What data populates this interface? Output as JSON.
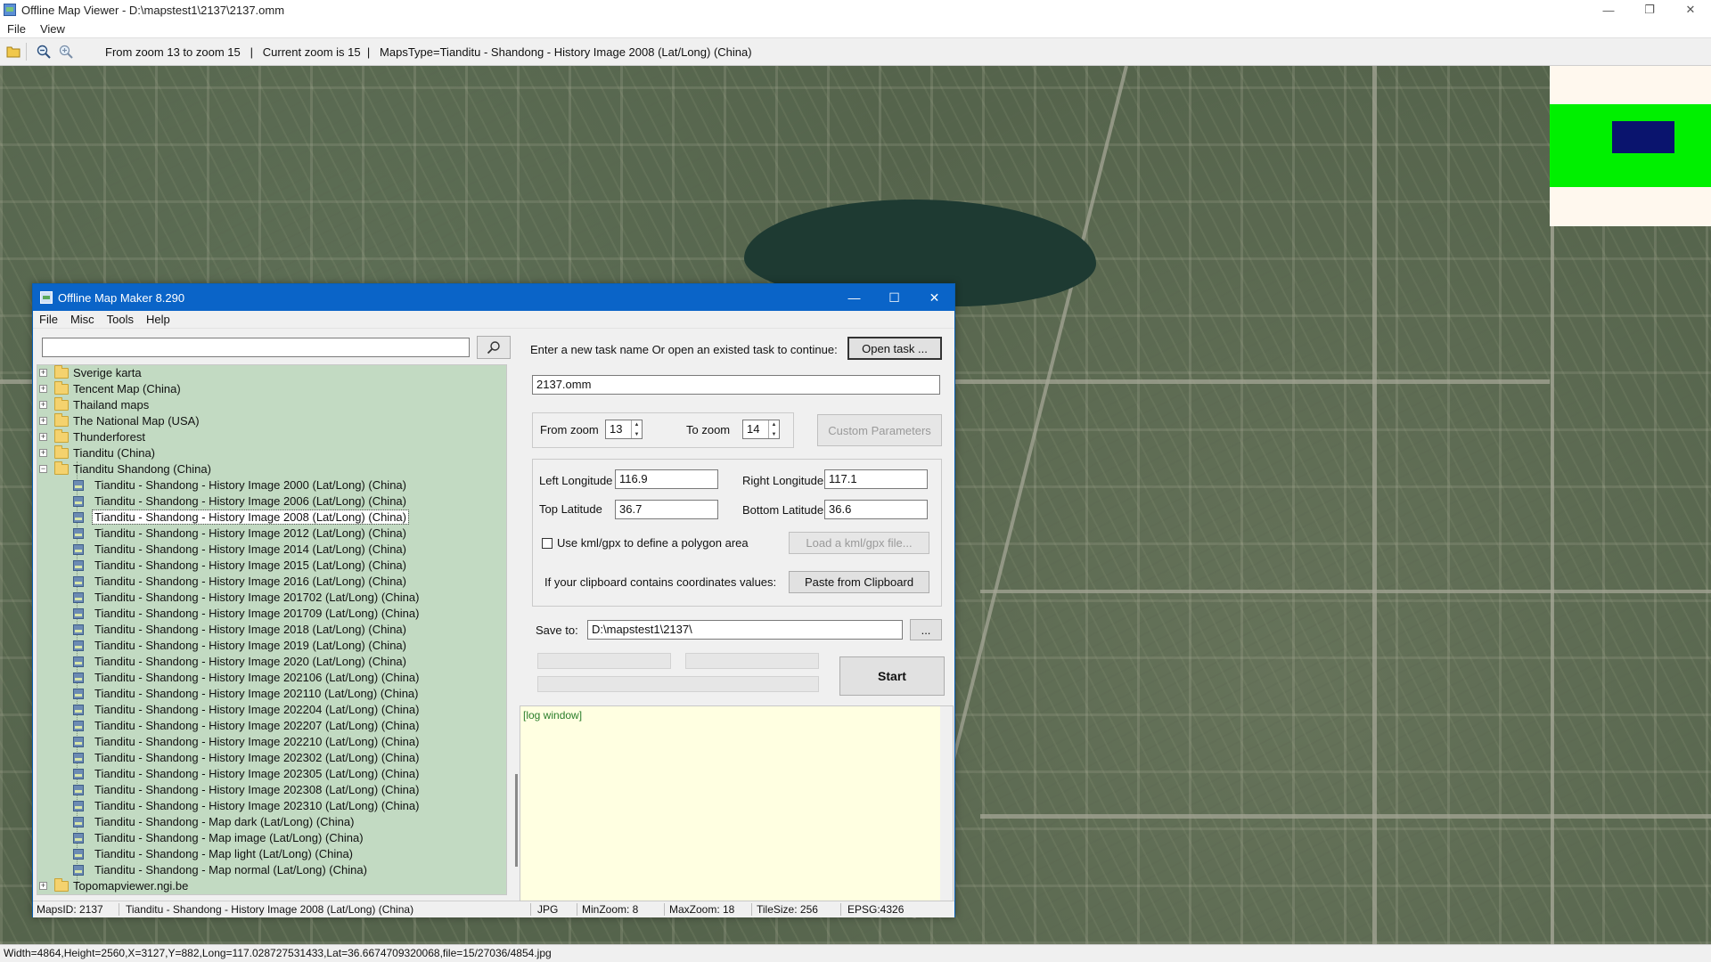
{
  "window": {
    "title": "Offline Map Viewer - D:\\mapstest1\\2137\\2137.omm",
    "controls": {
      "minimize": "—",
      "restore": "❐",
      "close": "✕"
    }
  },
  "menu": {
    "file": "File",
    "view": "View"
  },
  "toolbar": {
    "icons": [
      "open-folder-icon",
      "zoom-out-icon",
      "zoom-in-icon"
    ],
    "info": "From zoom 13 to zoom 15   |   Current zoom is 15  |   MapsType=Tianditu - Shandong - History Image 2008 (Lat/Long) (China)"
  },
  "status_main": "Width=4864,Height=2560,X=3127,Y=882,Long=117.028727531433,Lat=36.6674709320068,file=15/27036/4854.jpg",
  "colors": {
    "overview_land": "#00f000",
    "overview_view": "#0a146e",
    "dialog_title_bg": "#0a64c8",
    "tree_bg": "#c2dac2",
    "log_bg": "#ffffe1"
  },
  "dialog": {
    "title": "Offline Map Maker 8.290",
    "menu": [
      "File",
      "Misc",
      "Tools",
      "Help"
    ],
    "search": {
      "value": "",
      "icon": "search-icon"
    },
    "tree": {
      "folders_before": [
        "Sverige karta",
        "Tencent Map (China)",
        "Thailand maps",
        "The National Map (USA)",
        "Thunderforest",
        "Tianditu (China)"
      ],
      "expanded_folder": "Tianditu Shandong (China)",
      "children": [
        "Tianditu - Shandong - History Image 2000 (Lat/Long) (China)",
        "Tianditu - Shandong - History Image 2006 (Lat/Long) (China)",
        "Tianditu - Shandong - History Image 2008 (Lat/Long) (China)",
        "Tianditu - Shandong - History Image 2012 (Lat/Long) (China)",
        "Tianditu - Shandong - History Image 2014 (Lat/Long) (China)",
        "Tianditu - Shandong - History Image 2015 (Lat/Long) (China)",
        "Tianditu - Shandong - History Image 2016 (Lat/Long) (China)",
        "Tianditu - Shandong - History Image 201702 (Lat/Long) (China)",
        "Tianditu - Shandong - History Image 201709 (Lat/Long) (China)",
        "Tianditu - Shandong - History Image 2018 (Lat/Long) (China)",
        "Tianditu - Shandong - History Image 2019 (Lat/Long) (China)",
        "Tianditu - Shandong - History Image 2020 (Lat/Long) (China)",
        "Tianditu - Shandong - History Image 202106 (Lat/Long) (China)",
        "Tianditu - Shandong - History Image 202110 (Lat/Long) (China)",
        "Tianditu - Shandong - History Image 202204 (Lat/Long) (China)",
        "Tianditu - Shandong - History Image 202207 (Lat/Long) (China)",
        "Tianditu - Shandong - History Image 202210 (Lat/Long) (China)",
        "Tianditu - Shandong - History Image 202302 (Lat/Long) (China)",
        "Tianditu - Shandong - History Image 202305 (Lat/Long) (China)",
        "Tianditu - Shandong - History Image 202308 (Lat/Long) (China)",
        "Tianditu - Shandong - History Image 202310 (Lat/Long) (China)",
        "Tianditu - Shandong - Map dark (Lat/Long) (China)",
        "Tianditu - Shandong - Map image (Lat/Long) (China)",
        "Tianditu - Shandong - Map light (Lat/Long) (China)",
        "Tianditu - Shandong - Map normal (Lat/Long) (China)"
      ],
      "selected_index": 2,
      "folders_after": [
        "Topomapviewer.ngi.be"
      ]
    },
    "task": {
      "prompt": "Enter a new task name Or open an existed task to continue:",
      "open_button": "Open task ...",
      "name_value": "2137.omm"
    },
    "zoom": {
      "from_label": "From zoom",
      "from_value": "13",
      "to_label": "To zoom",
      "to_value": "14",
      "custom_button": "Custom Parameters"
    },
    "coords": {
      "left_lon_label": "Left Longitude",
      "left_lon": "116.9",
      "right_lon_label": "Right Longitude",
      "right_lon": "117.1",
      "top_lat_label": "Top Latitude",
      "top_lat": "36.7",
      "bottom_lat_label": "Bottom Latitude",
      "bottom_lat": "36.6",
      "kml_label": "Use kml/gpx to define a polygon area",
      "kml_checked": false,
      "kml_button": "Load a kml/gpx file...",
      "clipboard_label": "If your clipboard contains coordinates values:",
      "clipboard_button": "Paste from Clipboard"
    },
    "save": {
      "label": "Save to:",
      "path": "D:\\mapstest1\\2137\\",
      "browse": "..."
    },
    "start_button": "Start",
    "log": "[log window]",
    "status": {
      "maps_id": "MapsID: 2137",
      "maps_name": "Tianditu - Shandong - History Image 2008 (Lat/Long) (China)",
      "format": "JPG",
      "min_zoom": "MinZoom: 8",
      "max_zoom": "MaxZoom: 18",
      "tile_size": "TileSize: 256",
      "epsg": "EPSG:4326"
    }
  }
}
